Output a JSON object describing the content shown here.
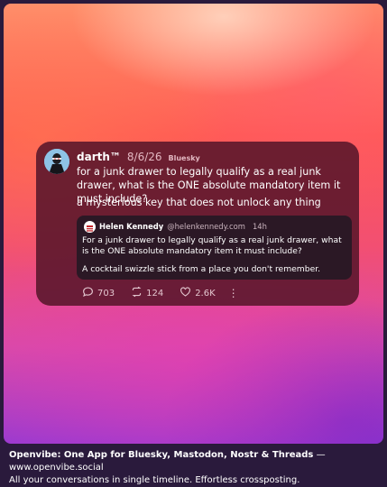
{
  "post": {
    "author_name": "darth™",
    "date": "8/6/26",
    "network": "Bluesky",
    "text": "for a junk drawer to legally qualify as a real junk drawer, what is the ONE absolute mandatory item it must include?",
    "reply": "a mysterious key that does not unlock any thing",
    "quote": {
      "author_name": "Helen Kennedy",
      "handle": "@helenkennedy.com",
      "time": "14h",
      "text": "For a junk drawer to legally qualify as a real junk drawer, what is the ONE absolute mandatory item it must include?",
      "reply": "A cocktail swizzle stick from a place you don't remember."
    },
    "stats": {
      "comments": "703",
      "reposts": "124",
      "likes": "2.6K"
    },
    "more_icon": "⋮"
  },
  "footer": {
    "brand": "Openvibe: One App for Bluesky, Mastodon, Nostr & Threads",
    "separator": " — ",
    "url": "www.openvibe.social",
    "tagline": "All your conversations in single timeline. Effortless crossposting."
  },
  "icons": [
    "avatar",
    "comment-icon",
    "repost-icon",
    "heart-icon",
    "more-icon"
  ],
  "colors": {
    "card": "#58162a",
    "quote": "#261824",
    "muted": "#e3b8c2"
  }
}
